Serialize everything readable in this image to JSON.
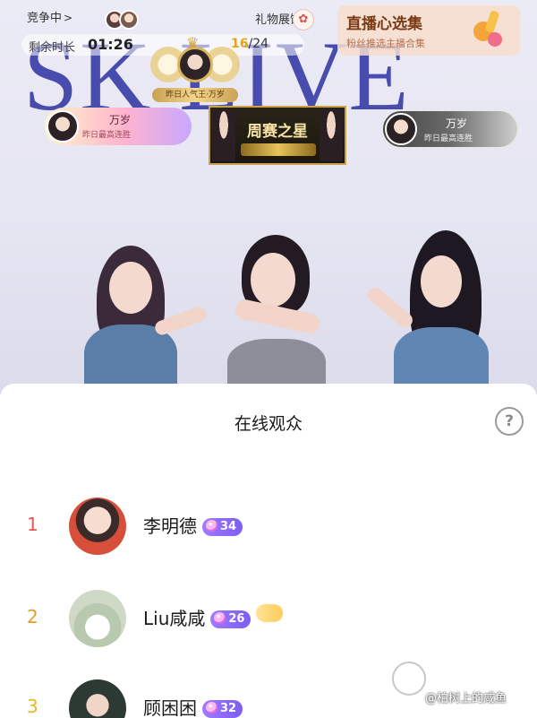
{
  "stream": {
    "watermark": "SK LIVE",
    "status_label": "竞争中",
    "gift_hall_label": "礼物展馆",
    "promo": {
      "title": "直播心选集",
      "subtitle": "粉丝推选主播合集"
    },
    "timer": {
      "label": "剩余时长",
      "time": "01:26",
      "rank_current": "16",
      "rank_total": "/24"
    },
    "crown_badge": {
      "label": "昨日人气王·万岁"
    },
    "badges": {
      "left": {
        "name": "万岁",
        "subtitle": "昨日最高连胜"
      },
      "center": {
        "title": "周赛之星"
      },
      "right": {
        "name": "万岁",
        "subtitle": "昨日最高连胜"
      }
    }
  },
  "sheet": {
    "title": "在线观众",
    "help_icon": "?",
    "viewers": [
      {
        "rank": "1",
        "name": "李明德",
        "level": "34",
        "avatar_icon": "user-avatar"
      },
      {
        "rank": "2",
        "name": "Liu咸咸",
        "level": "26",
        "fan_badge": "",
        "avatar_icon": "user-avatar"
      },
      {
        "rank": "3",
        "name": "顾困困",
        "level": "32",
        "avatar_icon": "user-avatar"
      }
    ]
  },
  "source_watermark": "@柏树上的咸鱼",
  "colors": {
    "watermark": "#3b3fa8",
    "rank1": "#e25656",
    "rank2": "#e59b2a",
    "rank3": "#e5b82a",
    "level_badge": "#8a68f7"
  }
}
